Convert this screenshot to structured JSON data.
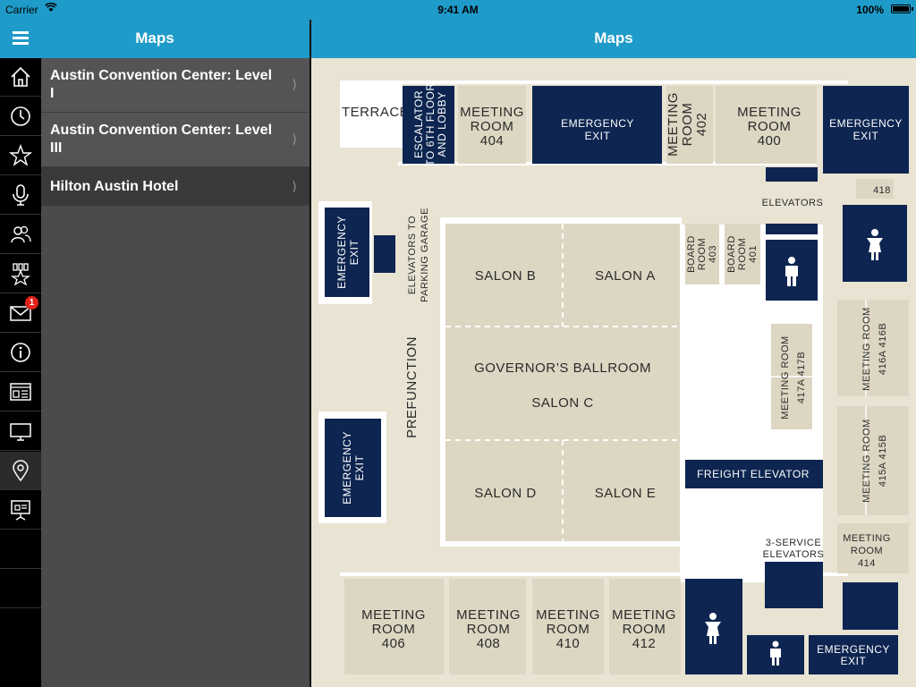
{
  "status_bar": {
    "carrier": "Carrier",
    "time": "9:41 AM",
    "battery": "100%"
  },
  "master": {
    "title": "Maps",
    "items": [
      {
        "label": "Austin Convention Center: Level I"
      },
      {
        "label": "Austin Convention Center: Level III"
      },
      {
        "label": "Hilton Austin Hotel"
      }
    ]
  },
  "detail": {
    "title": "Maps"
  },
  "sidebar": {
    "icons": [
      "home-icon",
      "clock-icon",
      "star-icon",
      "microphone-icon",
      "people-icon",
      "awards-icon",
      "mail-icon",
      "info-icon",
      "news-icon",
      "monitor-icon",
      "map-pin-icon",
      "presentation-icon"
    ],
    "mail_badge": "1"
  },
  "colors": {
    "accent": "#1f9bc9",
    "room_navy": "#0d2550",
    "room_beige": "#dcd6c2",
    "corridor": "#e8e3d3"
  },
  "map": {
    "labels": {
      "terrace": "TERRACE",
      "escalator": [
        "ESCALATOR",
        "TO 6TH FLOOR",
        "AND LOBBY"
      ],
      "room404": [
        "MEETING",
        "ROOM",
        "404"
      ],
      "exit_top1": [
        "EMERGENCY",
        "EXIT"
      ],
      "room402": [
        "MEETING",
        "ROOM",
        "402"
      ],
      "room400": [
        "MEETING",
        "ROOM",
        "400"
      ],
      "exit_top2": [
        "EMERGENCY",
        "EXIT"
      ],
      "elevators": "ELEVATORS",
      "room418": "418",
      "exit_left1": [
        "EMERGENCY",
        "EXIT"
      ],
      "elev_parking": [
        "ELEVATORS TO",
        "PARKING GARAGE"
      ],
      "salon_b": "SALON B",
      "salon_a": "SALON A",
      "board403": [
        "BOARD",
        "ROOM",
        "403"
      ],
      "board401": [
        "BOARD",
        "ROOM",
        "401"
      ],
      "prefunction": "PREFUNCTION",
      "governors": "GOVERNOR’S BALLROOM",
      "salon_c": "SALON C",
      "room417": [
        "MEETING ROOM",
        "417A   417B"
      ],
      "room416": [
        "MEETING ROOM",
        "416A   416B"
      ],
      "room415": [
        "MEETING ROOM",
        "415A   415B"
      ],
      "exit_left2": [
        "EMERGENCY",
        "EXIT"
      ],
      "salon_d": "SALON D",
      "salon_e": "SALON E",
      "freight": "FREIGHT ELEVATOR",
      "service_elev": [
        "3-SERVICE",
        "ELEVATORS"
      ],
      "room414": [
        "MEETING",
        "ROOM",
        "414"
      ],
      "room406": [
        "MEETING",
        "ROOM",
        "406"
      ],
      "room408": [
        "MEETING",
        "ROOM",
        "408"
      ],
      "room410": [
        "MEETING",
        "ROOM",
        "410"
      ],
      "room412": [
        "MEETING",
        "ROOM",
        "412"
      ],
      "exit_bottom": [
        "EMERGENCY",
        "EXIT"
      ]
    }
  }
}
